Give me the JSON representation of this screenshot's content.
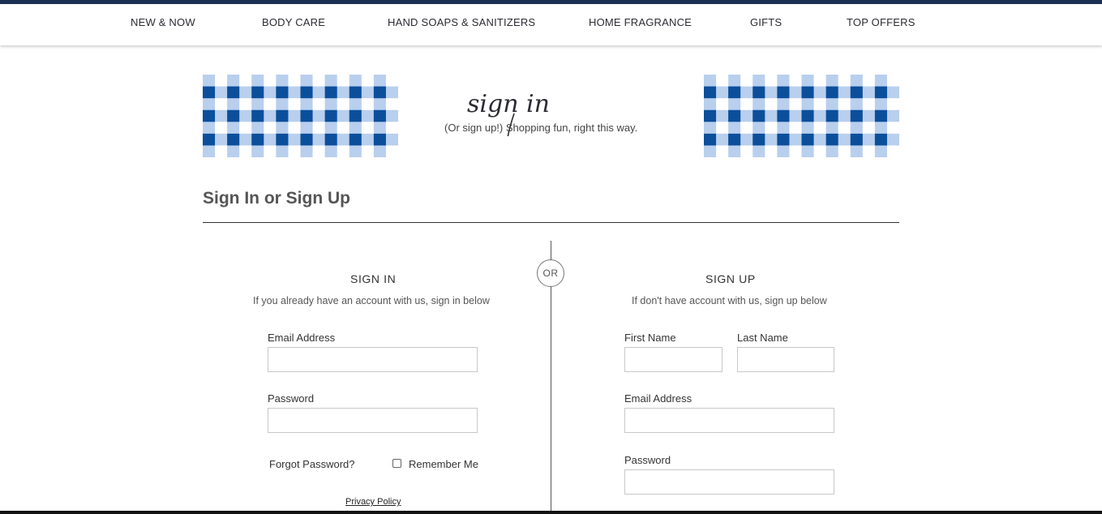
{
  "nav": {
    "items": [
      {
        "label": "NEW & NOW"
      },
      {
        "label": "BODY CARE"
      },
      {
        "label": "HAND SOAPS & SANITIZERS"
      },
      {
        "label": "HOME FRAGRANCE"
      },
      {
        "label": "GIFTS"
      },
      {
        "label": "TOP OFFERS"
      }
    ]
  },
  "hero": {
    "script_text": "sign in",
    "subtitle": "(Or sign up!) Shopping fun, right this way.",
    "plaid_colors": {
      "dark": "#0b4f9b",
      "light": "#b9cfee"
    }
  },
  "page": {
    "title": "Sign In or Sign Up",
    "or_label": "OR"
  },
  "sign_in": {
    "heading": "SIGN IN",
    "subheading": "If you already have an account with us, sign in below",
    "email_label": "Email Address",
    "email_value": "",
    "password_label": "Password",
    "password_value": "",
    "forgot_label": "Forgot Password?",
    "remember_label": "Remember Me",
    "remember_checked": false,
    "privacy_label": "Privacy Policy"
  },
  "sign_up": {
    "heading": "SIGN UP",
    "subheading": "If don't have account with us, sign up below",
    "first_name_label": "First Name",
    "last_name_label": "Last Name",
    "email_label": "Email Address",
    "password_label": "Password"
  }
}
